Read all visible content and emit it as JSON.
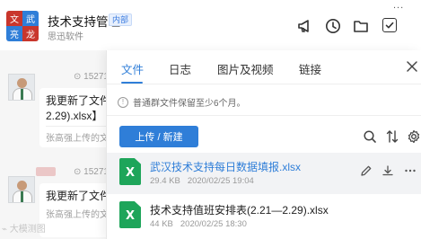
{
  "header": {
    "logo_chars": [
      "文",
      "武",
      "亮",
      "龙"
    ],
    "title": "技术支持管理",
    "tag": "内部",
    "subtitle": "思迅软件",
    "icons": [
      "megaphone-icon",
      "clock-icon",
      "folder-icon",
      "checklist-icon"
    ],
    "more": "..."
  },
  "chat": {
    "messages": [
      {
        "user": "15271",
        "text1": "我更新了文件",
        "text2": "2.29).xlsx】",
        "sender_note": "张高强上传的文"
      },
      {
        "user": "15271",
        "text1": "我更新了文件",
        "text2": "",
        "sender_note": "张高强上传的文"
      }
    ],
    "watermark": "⌁ 大模测图"
  },
  "panel": {
    "tabs": [
      "文件",
      "日志",
      "图片及视频",
      "链接"
    ],
    "active_tab": 0,
    "notice": "普通群文件保留至少6个月。",
    "upload_button": "上传 / 新建",
    "toolbar_icons": [
      "search-icon",
      "sort-icon",
      "settings-icon"
    ],
    "files": [
      {
        "name": "武汉技术支持每日数据填报.xlsx",
        "size": "29.4 KB",
        "date": "2020/02/25 19:04",
        "icon_letter": "X",
        "highlighted": true,
        "actions": [
          "edit-icon",
          "download-icon",
          "more-icon"
        ]
      },
      {
        "name": "技术支持值班安排表(2.21—2.29).xlsx",
        "size": "44 KB",
        "date": "2020/02/25 18:30",
        "icon_letter": "X",
        "highlighted": false,
        "actions": []
      }
    ]
  },
  "colors": {
    "accent": "#2f7ed8",
    "excel_green": "#1ea55a",
    "logo_red": "#c9362c"
  }
}
